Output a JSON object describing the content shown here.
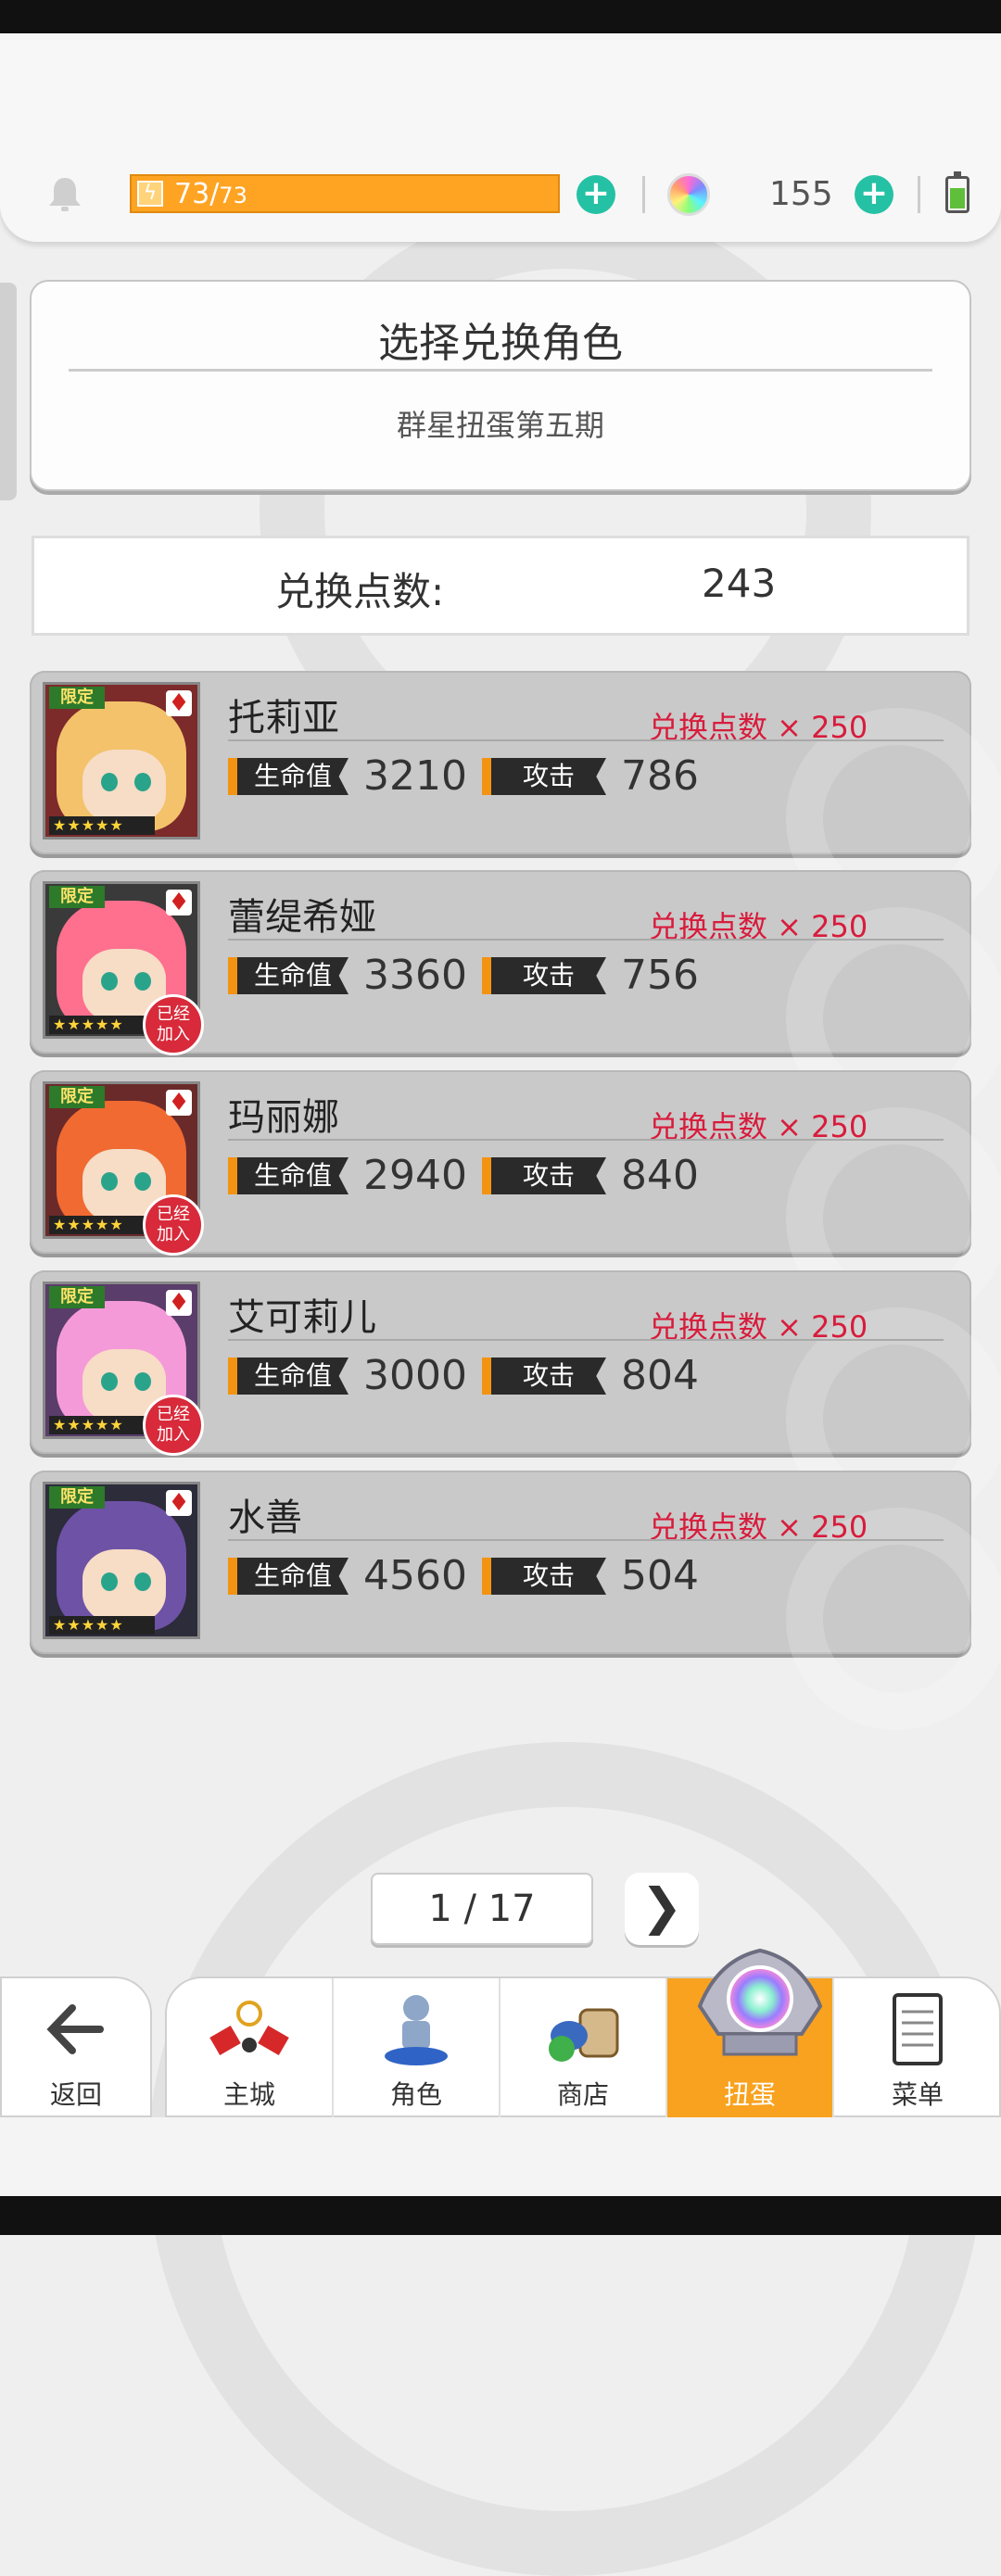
{
  "status": {
    "stamina_current": "73",
    "stamina_sep": "/",
    "stamina_max": "73",
    "gem_count": "155"
  },
  "title_card": {
    "title": "选择兑换角色",
    "subtitle": "群星扭蛋第五期"
  },
  "points": {
    "label": "兑换点数:",
    "value": "243"
  },
  "characters": [
    {
      "name": "托莉亚",
      "cost": "兑换点数 × 250",
      "hp_label": "生命值",
      "hp": "3210",
      "atk_label": "攻击",
      "atk": "786",
      "joined": false
    },
    {
      "name": "蕾缇希娅",
      "cost": "兑换点数 × 250",
      "hp_label": "生命值",
      "hp": "3360",
      "atk_label": "攻击",
      "atk": "756",
      "joined": true
    },
    {
      "name": "玛丽娜",
      "cost": "兑换点数 × 250",
      "hp_label": "生命值",
      "hp": "2940",
      "atk_label": "攻击",
      "atk": "840",
      "joined": true
    },
    {
      "name": "艾可莉儿",
      "cost": "兑换点数 × 250",
      "hp_label": "生命值",
      "hp": "3000",
      "atk_label": "攻击",
      "atk": "804",
      "joined": true
    },
    {
      "name": "水善",
      "cost": "兑换点数 × 250",
      "hp_label": "生命值",
      "hp": "4560",
      "atk_label": "攻击",
      "atk": "504",
      "joined": false
    }
  ],
  "badges": {
    "limited": "限定",
    "joined_line1": "已经",
    "joined_line2": "加入",
    "stars": "★★★★★"
  },
  "pager": {
    "text": "1 / 17",
    "next": "❯"
  },
  "nav": {
    "back": "返回",
    "main_city": "主城",
    "character": "角色",
    "shop": "商店",
    "gacha": "扭蛋",
    "menu": "菜单"
  },
  "icons": {
    "bell": "bell-icon",
    "bolt": "lightning-icon",
    "plus": "plus-icon",
    "gem": "rainbow-gem-icon",
    "battery": "battery-icon"
  },
  "colors": {
    "stamina": "#ffa323",
    "plus": "#25c1a4",
    "cost_text": "#d81c3c",
    "active_tab": "#f8a21f",
    "joined_badge": "#d82a3a"
  }
}
